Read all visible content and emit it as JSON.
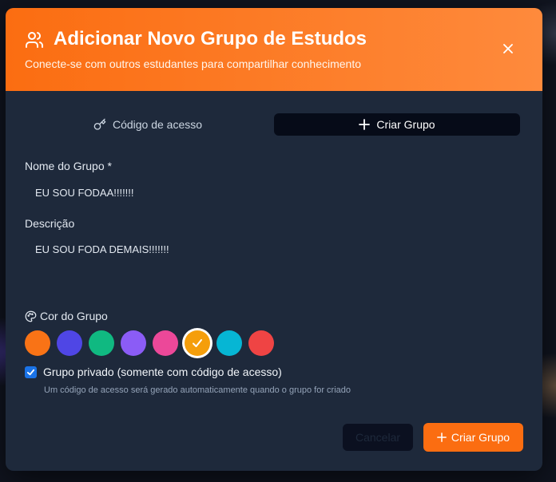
{
  "dialog": {
    "title": "Adicionar Novo Grupo de Estudos",
    "subtitle": "Conecte-se com outros estudantes para compartilhar conhecimento"
  },
  "tabs": [
    {
      "label": "Código de acesso",
      "icon": "key-icon",
      "active": false
    },
    {
      "label": "Criar Grupo",
      "icon": "plus-icon",
      "active": true
    }
  ],
  "form": {
    "name_label": "Nome do Grupo *",
    "name_value": "EU SOU FODAA!!!!!!!",
    "description_label": "Descrição",
    "description_value": "EU SOU FODA DEMAIS!!!!!!!",
    "color_label": "Cor do Grupo",
    "colors": [
      {
        "hex": "#f97316",
        "selected": false
      },
      {
        "hex": "#4f46e5",
        "selected": false
      },
      {
        "hex": "#10b981",
        "selected": false
      },
      {
        "hex": "#8b5cf6",
        "selected": false
      },
      {
        "hex": "#ec4899",
        "selected": false
      },
      {
        "hex": "#f59e0b",
        "selected": true
      },
      {
        "hex": "#06b6d4",
        "selected": false
      },
      {
        "hex": "#ef4444",
        "selected": false
      }
    ],
    "private_label": "Grupo privado (somente com código de acesso)",
    "private_checked": true,
    "private_hint": "Um código de acesso será gerado automaticamente quando o grupo for criado"
  },
  "actions": {
    "cancel_label": "Cancelar",
    "create_label": "Criar Grupo"
  },
  "theme": {
    "accent": "#fb6d11",
    "panel": "#1e293b"
  }
}
